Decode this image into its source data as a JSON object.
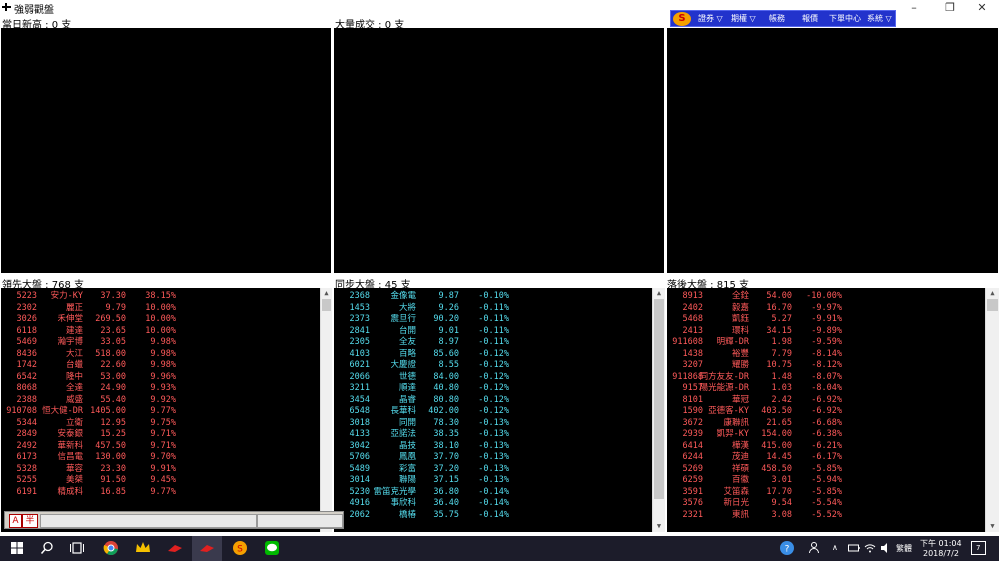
{
  "window": {
    "title": "強弱觀盤",
    "min": "–",
    "restore": "❐",
    "close": "✕"
  },
  "toolbar": {
    "logo": "S",
    "items": [
      "證券 ▽",
      "期權 ▽",
      "帳務",
      "報價",
      "下單中心",
      "系統 ▽"
    ]
  },
  "sections": {
    "top_left": "當日新高 : 0 支",
    "top_middle": "大量成交 : 0 支",
    "top_right": "",
    "bottom_left": "領先大盤 : 768 支",
    "bottom_middle": "同步大盤 : 45 支",
    "bottom_right": "落後大盤 : 815 支"
  },
  "lead_list": [
    [
      "5223",
      "安力-KY",
      "37.30",
      "38.15%"
    ],
    [
      "2302",
      "麗正",
      "9.79",
      "10.00%"
    ],
    [
      "3026",
      "禾伸堂",
      "269.50",
      "10.00%"
    ],
    [
      "6118",
      "建達",
      "23.65",
      "10.00%"
    ],
    [
      "5469",
      "瀚宇博",
      "33.05",
      "9.98%"
    ],
    [
      "8436",
      "大江",
      "518.00",
      "9.98%"
    ],
    [
      "1742",
      "台蠟",
      "22.60",
      "9.98%"
    ],
    [
      "6542",
      "隆中",
      "53.00",
      "9.96%"
    ],
    [
      "8068",
      "全達",
      "24.90",
      "9.93%"
    ],
    [
      "2388",
      "威盛",
      "55.40",
      "9.92%"
    ],
    [
      "910708",
      "恒大健-DR",
      "1405.00",
      "9.77%"
    ],
    [
      "5344",
      "立衛",
      "12.95",
      "9.75%"
    ],
    [
      "2849",
      "安泰銀",
      "15.25",
      "9.71%"
    ],
    [
      "2492",
      "華新科",
      "457.50",
      "9.71%"
    ],
    [
      "6173",
      "信昌電",
      "130.00",
      "9.70%"
    ],
    [
      "5328",
      "華容",
      "23.30",
      "9.91%"
    ],
    [
      "5255",
      "美桀",
      "91.50",
      "9.45%"
    ],
    [
      "6191",
      "精成科",
      "16.85",
      "9.77%"
    ]
  ],
  "sync_list": [
    [
      "2368",
      "金像電",
      "9.87",
      "-0.10%"
    ],
    [
      "1453",
      "大將",
      "9.26",
      "-0.11%"
    ],
    [
      "2373",
      "震旦行",
      "90.20",
      "-0.11%"
    ],
    [
      "2841",
      "台開",
      "9.01",
      "-0.11%"
    ],
    [
      "2305",
      "全友",
      "8.97",
      "-0.11%"
    ],
    [
      "4103",
      "百略",
      "85.60",
      "-0.12%"
    ],
    [
      "6021",
      "大慶證",
      "8.55",
      "-0.12%"
    ],
    [
      "2066",
      "世德",
      "84.00",
      "-0.12%"
    ],
    [
      "3211",
      "順達",
      "40.80",
      "-0.12%"
    ],
    [
      "3454",
      "晶睿",
      "80.80",
      "-0.12%"
    ],
    [
      "6548",
      "長華科",
      "402.00",
      "-0.12%"
    ],
    [
      "3018",
      "同開",
      "78.30",
      "-0.13%"
    ],
    [
      "4133",
      "亞諾法",
      "38.35",
      "-0.13%"
    ],
    [
      "3042",
      "晶技",
      "38.10",
      "-0.13%"
    ],
    [
      "5706",
      "鳳凰",
      "37.70",
      "-0.13%"
    ],
    [
      "5489",
      "彩富",
      "37.20",
      "-0.13%"
    ],
    [
      "3014",
      "聯陽",
      "37.15",
      "-0.13%"
    ],
    [
      "5230",
      "雷笛克光學",
      "36.80",
      "-0.14%"
    ],
    [
      "4916",
      "事欣科",
      "36.40",
      "-0.14%"
    ],
    [
      "2062",
      "橋椿",
      "35.75",
      "-0.14%"
    ]
  ],
  "lag_list": [
    [
      "8913",
      "全銓",
      "54.00",
      "-10.00%"
    ],
    [
      "2402",
      "毅嘉",
      "16.70",
      "-9.97%"
    ],
    [
      "5468",
      "凱鈺",
      "5.27",
      "-9.91%"
    ],
    [
      "2413",
      "環科",
      "34.15",
      "-9.89%"
    ],
    [
      "911608",
      "明輝-DR",
      "1.98",
      "-9.59%"
    ],
    [
      "1438",
      "裕豐",
      "7.79",
      "-8.14%"
    ],
    [
      "3207",
      "耀勝",
      "10.75",
      "-8.12%"
    ],
    [
      "911868",
      "同方友友-DR",
      "1.48",
      "-8.07%"
    ],
    [
      "9157",
      "陽光能源-DR",
      "1.03",
      "-8.04%"
    ],
    [
      "8101",
      "華冠",
      "2.42",
      "-6.92%"
    ],
    [
      "1590",
      "亞德客-KY",
      "403.50",
      "-6.92%"
    ],
    [
      "3672",
      "康聯訊",
      "21.65",
      "-6.68%"
    ],
    [
      "2939",
      "凱羿-KY",
      "154.00",
      "-6.38%"
    ],
    [
      "6414",
      "樺漢",
      "415.00",
      "-6.21%"
    ],
    [
      "6244",
      "茂迪",
      "14.45",
      "-6.17%"
    ],
    [
      "5269",
      "祥碩",
      "458.50",
      "-5.85%"
    ],
    [
      "6259",
      "百徽",
      "3.01",
      "-5.94%"
    ],
    [
      "3591",
      "艾笛森",
      "17.70",
      "-5.85%"
    ],
    [
      "3576",
      "新日光",
      "9.54",
      "-5.54%"
    ],
    [
      "2321",
      "東訊",
      "3.08",
      "-5.52%"
    ]
  ],
  "input": {
    "ime_mode": "A",
    "ime_width": "半"
  },
  "taskbar": {
    "lang": "繁體",
    "time": "下午 01:04",
    "date": "2018/7/2",
    "notify_count": "7"
  },
  "colors": {
    "lead": "#ff5a5a",
    "sync": "#55ddee",
    "lag": "#ff5a5a",
    "panel_bg": "#000000",
    "toolbar_bg": "#2233cc"
  }
}
